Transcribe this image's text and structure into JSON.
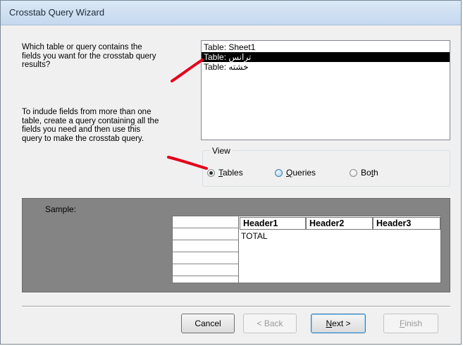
{
  "window": {
    "title": "Crosstab Query Wizard"
  },
  "prompt": {
    "question_lines": [
      "Which table or query contains the",
      "fields you want for the crosstab query",
      "results?"
    ],
    "hint_lines": [
      "To indude fields from more than one",
      "table, create a query containing all the",
      "fields you need and then use this",
      "query to make the crosstab query."
    ]
  },
  "listbox": {
    "items": [
      "Table: Sheet1",
      "Table: ترانس",
      "Table: خشته"
    ],
    "selected_index": 1
  },
  "view": {
    "legend": "View",
    "options": [
      {
        "key": "T",
        "rest": "ables",
        "checked": true
      },
      {
        "key": "Q",
        "rest": "ueries",
        "checked": false
      },
      {
        "key": "B",
        "pre": "Bo",
        "key2": "t",
        "rest": "h",
        "checked": false
      }
    ]
  },
  "sample": {
    "label": "Sample:",
    "headers": [
      "Header1",
      "Header2",
      "Header3"
    ],
    "total_label": "TOTAL"
  },
  "buttons": {
    "cancel": "Cancel",
    "back": "< Back",
    "next": "Next >",
    "finish": "Finish"
  },
  "colors": {
    "annotation": "#e3001b",
    "selection": "#000000",
    "sample_bg": "#848484"
  }
}
